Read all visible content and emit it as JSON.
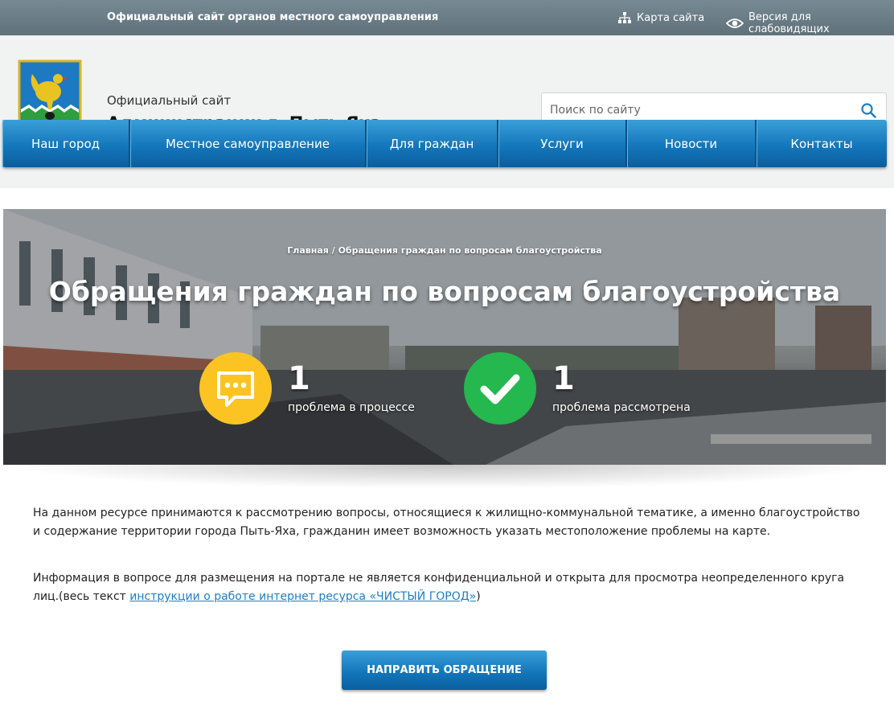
{
  "topbar": {
    "official_text": "Официальный сайт органов местного самоуправления",
    "sitemap_label": "Карта сайта",
    "sitemap_icon": "sitemap-icon",
    "vision_label": "Версия для слабовидящих",
    "vision_icon": "eye-icon"
  },
  "header": {
    "subtitle": "Официальный сайт",
    "title": "Администрации г. Пыть-Яха",
    "search_placeholder": "Поиск по сайту",
    "search_icon": "search-icon"
  },
  "nav": {
    "items": [
      {
        "label": "Наш город"
      },
      {
        "label": "Местное самоуправление"
      },
      {
        "label": "Для граждан"
      },
      {
        "label": "Услуги"
      },
      {
        "label": "Новости"
      },
      {
        "label": "Контакты"
      }
    ]
  },
  "hero": {
    "breadcrumb_home": "Главная",
    "breadcrumb_sep": "/",
    "breadcrumb_current": "Обращения граждан по вопросам благоустройства",
    "title": "Обращения граждан по вопросам благоустройства",
    "stats": [
      {
        "value": "1",
        "label": "проблема в процессе",
        "icon": "chat-bubble-icon",
        "color": "#fcc423"
      },
      {
        "value": "1",
        "label": "проблема рассмотрена",
        "icon": "checkmark-icon",
        "color": "#24b84e"
      }
    ]
  },
  "content": {
    "paragraph1": "На данном ресурсе принимаются к рассмотрению вопросы, относящиеся к жилищно-коммунальной тематике, а именно благоустройство и содержание территории города Пыть-Яха, гражданин имеет возможность указать местоположение проблемы на карте.",
    "paragraph2_text": "Информация в вопросе для размещения на портале не является конфиденциальной и открыта для просмотра неопределенного круга лиц.(весь текст ",
    "paragraph2_link": "инструкции о работе интернет ресурса «ЧИСТЫЙ ГОРОД»",
    "paragraph2_end": ")",
    "submit_label": "НАПРАВИТЬ ОБРАЩЕНИЕ"
  },
  "colors": {
    "nav_blue": "#1377bb",
    "topbar": "#6b7d86",
    "link": "#1c7fc7"
  }
}
